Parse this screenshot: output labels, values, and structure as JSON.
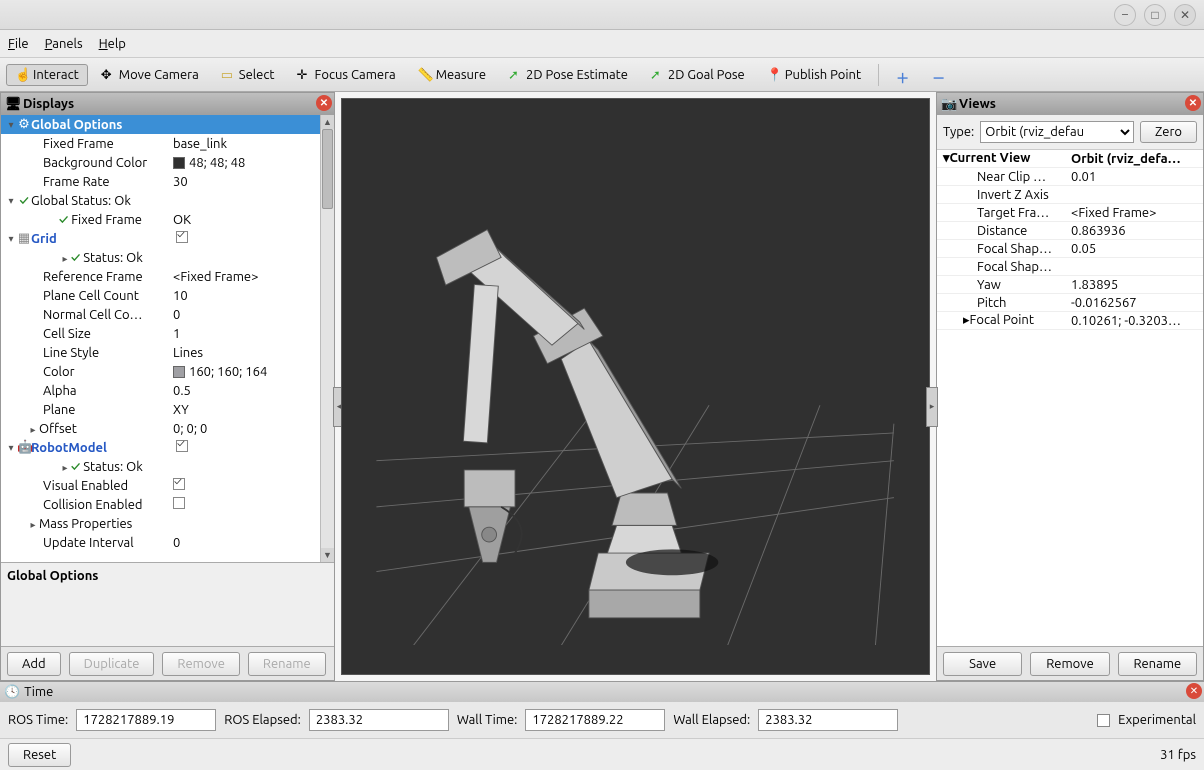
{
  "menubar": {
    "file": "File",
    "panels": "Panels",
    "help": "Help"
  },
  "toolbar": {
    "interact": "Interact",
    "move": "Move Camera",
    "select": "Select",
    "focus": "Focus Camera",
    "measure": "Measure",
    "pose2d": "2D Pose Estimate",
    "goal2d": "2D Goal Pose",
    "publish": "Publish Point"
  },
  "displays": {
    "title": "Displays",
    "global_options": "Global Options",
    "props": {
      "fixed_frame_k": "Fixed Frame",
      "fixed_frame_v": "base_link",
      "bg_k": "Background Color",
      "bg_v": "48; 48; 48",
      "fr_k": "Frame Rate",
      "fr_v": "30"
    },
    "global_status": "Global Status: Ok",
    "gs_fixed_k": "Fixed Frame",
    "gs_fixed_v": "OK",
    "grid": "Grid",
    "grid_props": {
      "status": "Status: Ok",
      "ref_k": "Reference Frame",
      "ref_v": "<Fixed Frame>",
      "pcc_k": "Plane Cell Count",
      "pcc_v": "10",
      "ncc_k": "Normal Cell Co…",
      "ncc_v": "0",
      "cs_k": "Cell Size",
      "cs_v": "1",
      "ls_k": "Line Style",
      "ls_v": "Lines",
      "col_k": "Color",
      "col_v": "160; 160; 164",
      "a_k": "Alpha",
      "a_v": "0.5",
      "plane_k": "Plane",
      "plane_v": "XY",
      "off_k": "Offset",
      "off_v": "0; 0; 0"
    },
    "robot": "RobotModel",
    "robot_props": {
      "status": "Status: Ok",
      "ve_k": "Visual Enabled",
      "ce_k": "Collision Enabled",
      "mp_k": "Mass Properties",
      "ui_k": "Update Interval",
      "ui_v": "0"
    },
    "desc": "Global Options",
    "buttons": {
      "add": "Add",
      "dup": "Duplicate",
      "rem": "Remove",
      "ren": "Rename"
    }
  },
  "views": {
    "title": "Views",
    "type_label": "Type:",
    "type_value": "Orbit (rviz_defau",
    "zero": "Zero",
    "current_view": "Current View",
    "current_view_v": "Orbit (rviz_defa…",
    "rows": [
      {
        "k": "Near Clip …",
        "v": "0.01"
      },
      {
        "k": "Invert Z Axis",
        "v": "[chk]"
      },
      {
        "k": "Target Fra…",
        "v": "<Fixed Frame>"
      },
      {
        "k": "Distance",
        "v": "0.863936"
      },
      {
        "k": "Focal Shap…",
        "v": "0.05"
      },
      {
        "k": "Focal Shap…",
        "v": "[chk-on]"
      },
      {
        "k": "Yaw",
        "v": "1.83895"
      },
      {
        "k": "Pitch",
        "v": "-0.0162567"
      },
      {
        "k": "Focal Point",
        "v": "0.10261; -0.3203…",
        "exp": true
      }
    ],
    "buttons": {
      "save": "Save",
      "remove": "Remove",
      "rename": "Rename"
    }
  },
  "time": {
    "title": "Time",
    "ros_time_l": "ROS Time:",
    "ros_time_v": "1728217889.19",
    "ros_el_l": "ROS Elapsed:",
    "ros_el_v": "2383.32",
    "wall_time_l": "Wall Time:",
    "wall_time_v": "1728217889.22",
    "wall_el_l": "Wall Elapsed:",
    "wall_el_v": "2383.32",
    "exp": "Experimental"
  },
  "footer": {
    "reset": "Reset",
    "fps": "31 fps"
  }
}
